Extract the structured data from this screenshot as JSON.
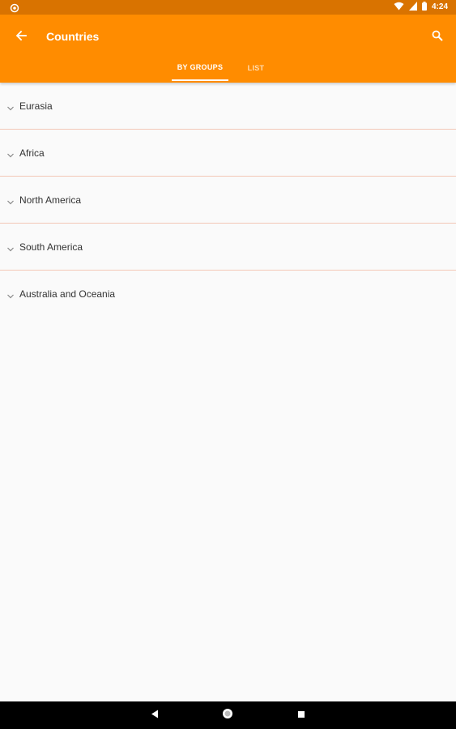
{
  "status_bar": {
    "time": "4:24",
    "icons": [
      "notification-icon",
      "wifi-icon",
      "cell-signal-icon",
      "battery-icon"
    ]
  },
  "app_bar": {
    "title": "Countries",
    "back_icon": "arrow-back-icon",
    "search_icon": "search-icon",
    "background_color": "#ff8c00"
  },
  "tabs": [
    {
      "label": "BY GROUPS",
      "active": true
    },
    {
      "label": "LIST",
      "active": false
    }
  ],
  "groups": [
    {
      "label": "Eurasia"
    },
    {
      "label": "Africa"
    },
    {
      "label": "North America"
    },
    {
      "label": "South America"
    },
    {
      "label": "Australia and Oceania"
    }
  ],
  "nav_bar": {
    "buttons": [
      "back-triangle-icon",
      "home-circle-icon",
      "recents-square-icon"
    ]
  }
}
